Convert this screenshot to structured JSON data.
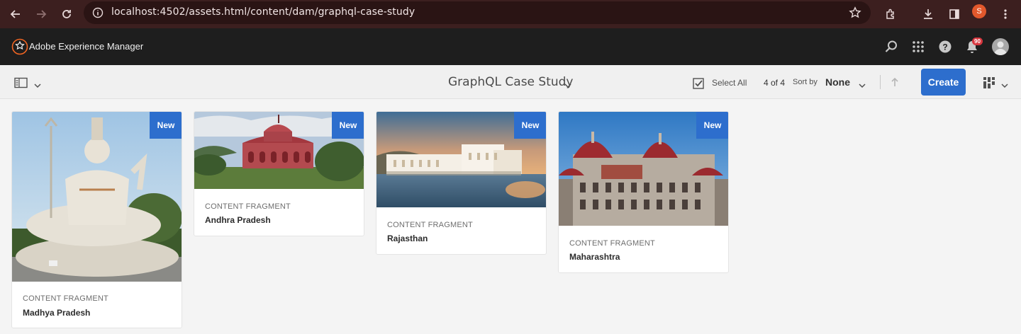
{
  "browser": {
    "url": "localhost:4502/assets.html/content/dam/graphql-case-study",
    "profile_initial": "S"
  },
  "shell": {
    "brand": "Adobe Experience Manager",
    "notification_count": "90"
  },
  "actionbar": {
    "title": "GraphQL Case Study",
    "select_all": "Select All",
    "count": "4 of 4",
    "sort_by": "Sort by",
    "sort_value": "None",
    "create": "Create"
  },
  "cards": [
    {
      "badge": "New",
      "type": "CONTENT FRAGMENT",
      "title": "Madhya Pradesh"
    },
    {
      "badge": "New",
      "type": "CONTENT FRAGMENT",
      "title": "Andhra Pradesh"
    },
    {
      "badge": "New",
      "type": "CONTENT FRAGMENT",
      "title": "Rajasthan"
    },
    {
      "badge": "New",
      "type": "CONTENT FRAGMENT",
      "title": "Maharashtra"
    }
  ],
  "colors": {
    "accent": "#2d6ecd",
    "shell": "#1e1e1e",
    "browser": "#3c1f1f"
  }
}
